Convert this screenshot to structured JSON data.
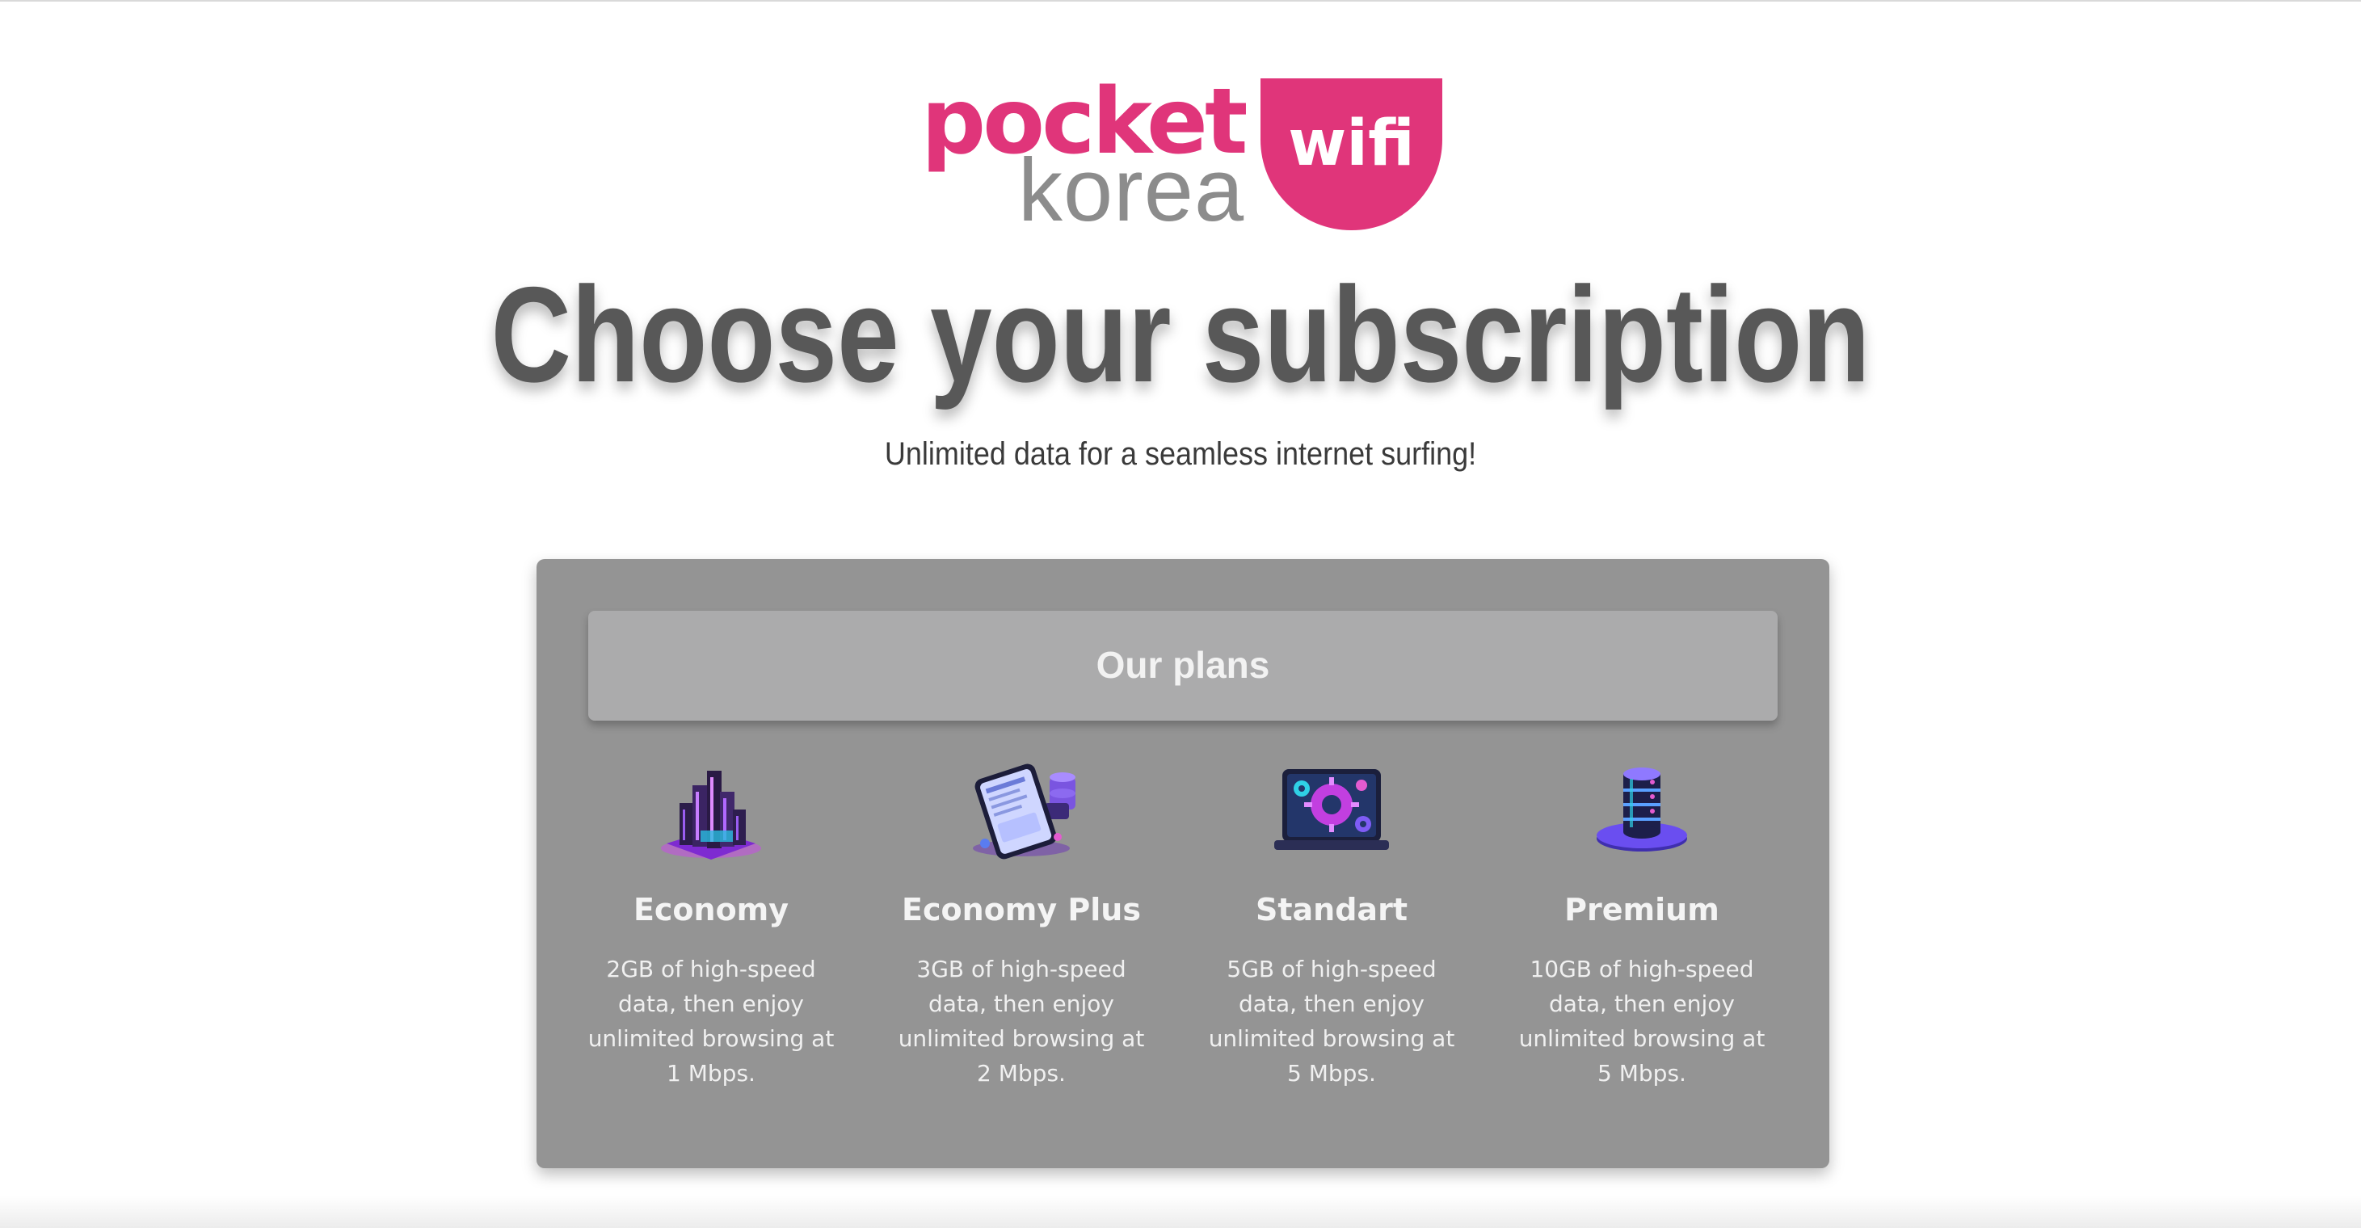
{
  "brand": {
    "logo_pocket": "pocket",
    "logo_korea": "korea",
    "logo_wifi": "wifi",
    "accent_color": "#e0357a"
  },
  "hero": {
    "title": "Choose your subscription",
    "subtitle": "Unlimited data for a seamless internet surfing!"
  },
  "plans_section": {
    "header": "Our plans",
    "plans": [
      {
        "icon": "city-block-icon",
        "name": "Economy",
        "description": "2GB of high-speed data, then enjoy unlimited browsing at 1 Mbps."
      },
      {
        "icon": "phone-document-icon",
        "name": "Economy Plus",
        "description": "3GB of high-speed data, then enjoy unlimited browsing at 2 Mbps."
      },
      {
        "icon": "laptop-gears-icon",
        "name": "Standart",
        "description": "5GB of high-speed data, then enjoy unlimited browsing at 5 Mbps."
      },
      {
        "icon": "database-server-icon",
        "name": "Premium",
        "description": "10GB of high-speed data, then enjoy unlimited browsing at 5 Mbps."
      }
    ]
  }
}
